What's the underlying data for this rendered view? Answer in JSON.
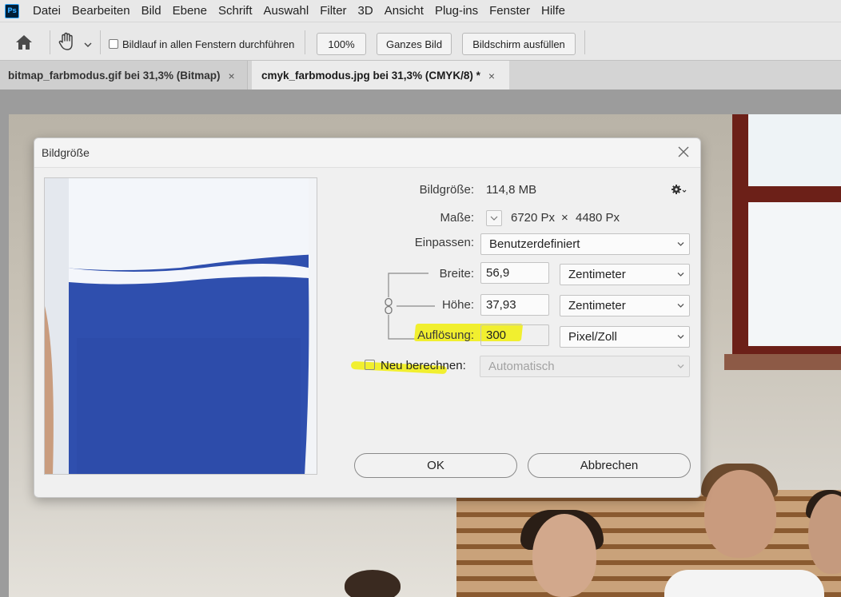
{
  "app": {
    "logo_text": "Ps"
  },
  "menu": [
    "Datei",
    "Bearbeiten",
    "Bild",
    "Ebene",
    "Schrift",
    "Auswahl",
    "Filter",
    "3D",
    "Ansicht",
    "Plug-ins",
    "Fenster",
    "Hilfe"
  ],
  "options_bar": {
    "scroll_all_label": "Bildlauf in allen Fenstern durchführen",
    "scroll_all_checked": false,
    "zoom_100_label": "100%",
    "fit_screen_label": "Ganzes Bild",
    "fill_screen_label": "Bildschirm ausfüllen"
  },
  "tabs": [
    {
      "label": "bitmap_farbmodus.gif bei 31,3% (Bitmap)",
      "close": "×",
      "active": false
    },
    {
      "label": "cmyk_farbmodus.jpg bei 31,3% (CMYK/8) *",
      "close": "×",
      "active": true
    }
  ],
  "dialog": {
    "title": "Bildgröße",
    "image_size_label": "Bildgröße:",
    "image_size_value": "114,8 MB",
    "dimensions_label": "Maße:",
    "dimensions_width": "6720 Px",
    "dimensions_times": "×",
    "dimensions_height": "4480 Px",
    "fit_label": "Einpassen:",
    "fit_value": "Benutzerdefiniert",
    "width_label": "Breite:",
    "width_value": "56,9",
    "width_unit": "Zentimeter",
    "height_label": "Höhe:",
    "height_value": "37,93",
    "height_unit": "Zentimeter",
    "resolution_label": "Auflösung:",
    "resolution_value": "300",
    "resolution_unit": "Pixel/Zoll",
    "resample_label": "Neu berechnen:",
    "resample_checked": false,
    "resample_method": "Automatisch",
    "ok_label": "OK",
    "cancel_label": "Abbrechen"
  },
  "colors": {
    "highlight": "#f1ee1a",
    "shirt_blue": "#2f4fae",
    "ps_blue": "#31a8ff"
  }
}
